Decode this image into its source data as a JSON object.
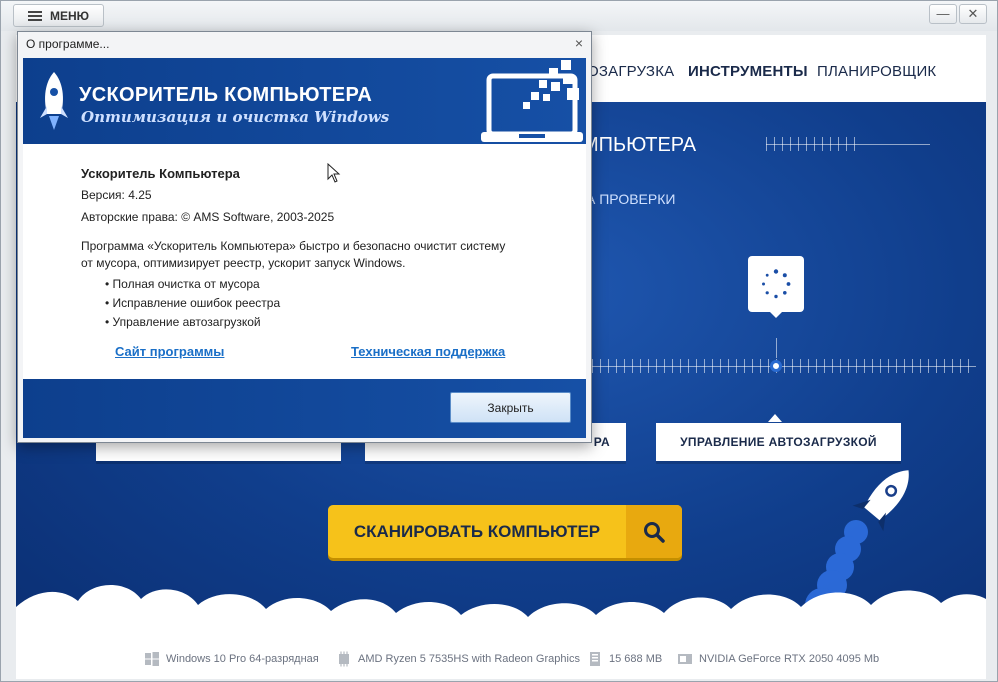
{
  "window": {
    "menu_label": "МЕНЮ",
    "minimize_glyph": "—",
    "close_glyph": "✕"
  },
  "nav": {
    "items": [
      "ОЗАГРУЗКА",
      "ИНСТРУМЕНТЫ",
      "ПЛАНИРОВЩИК"
    ]
  },
  "main": {
    "heading_fragment": "МПЬЮТЕРА",
    "sub_fragment": "А ПРОВЕРКИ",
    "tabs": [
      "РА",
      "УПРАВЛЕНИЕ АВТОЗАГРУЗКОЙ"
    ],
    "scan_button": "СКАНИРОВАТЬ КОМПЬЮТЕР"
  },
  "status_bar": {
    "os": "Windows 10 Pro 64-разрядная",
    "cpu": "AMD Ryzen 5 7535HS with Radeon Graphics",
    "ram": "15 688 MB",
    "gpu": "NVIDIA GeForce RTX 2050 4095 Mb"
  },
  "dialog": {
    "title": "О программе...",
    "close_glyph": "×",
    "brand_name": "УСКОРИТЕЛЬ КОМПЬЮТЕРА",
    "brand_tagline": "Оптимизация и очистка Windows",
    "product_name": "Ускоритель Компьютера",
    "version": "Версия: 4.25",
    "copyright": "Авторские права: © AMS Software, 2003-2025",
    "description_line1": "Программа «Ускоритель Компьютера» быстро и безопасно очистит систему",
    "description_line2": "от мусора, оптимизирует реестр, ускорит запуск Windows.",
    "bullets": [
      "• Полная очистка от мусора",
      "• Исправление ошибок реестра",
      "• Управление автозагрузкой"
    ],
    "link_site": "Сайт программы",
    "link_support": "Техническая поддержка",
    "close_button": "Закрыть"
  },
  "colors": {
    "brand_blue": "#103e8c",
    "accent_yellow": "#f6c21a",
    "link_blue": "#1a6fc7"
  }
}
